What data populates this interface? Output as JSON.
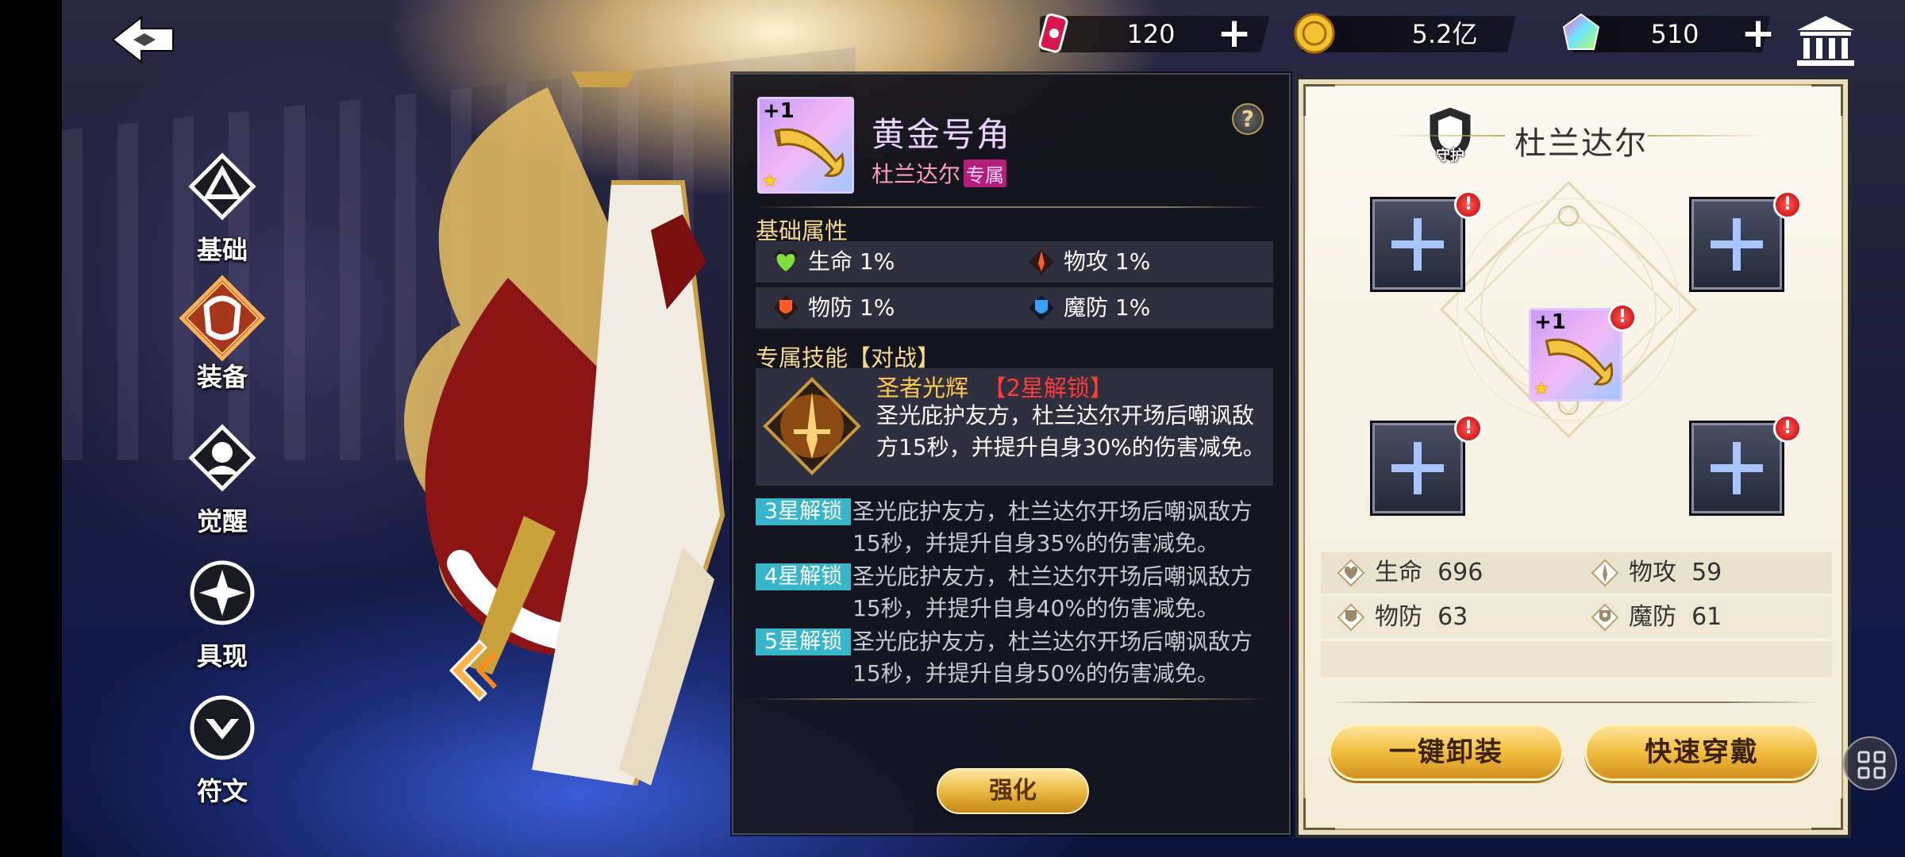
{
  "topbar": {
    "stamina": {
      "value": "120",
      "icon": "stamina-can-icon"
    },
    "gold": {
      "value": "5.2亿",
      "icon": "gold-coin-icon"
    },
    "gems": {
      "value": "510",
      "icon": "gem-icon"
    }
  },
  "nav": {
    "items": [
      {
        "label": "基础",
        "icon": "basics-icon"
      },
      {
        "label": "装备",
        "icon": "equipment-icon",
        "active": true
      },
      {
        "label": "觉醒",
        "icon": "awaken-icon"
      },
      {
        "label": "具现",
        "icon": "manifest-icon"
      },
      {
        "label": "符文",
        "icon": "rune-icon"
      }
    ]
  },
  "detail": {
    "item_level": "+1",
    "item_name": "黄金号角",
    "owner": "杜兰达尔",
    "exclusive_badge": "专属",
    "help": "?",
    "base_attr_title": "基础属性",
    "stats": [
      {
        "label": "生命 1%",
        "icon": "heart-icon",
        "color": "#7ee03c"
      },
      {
        "label": "物攻 1%",
        "icon": "sword-icon",
        "color": "#ff5a2a"
      },
      {
        "label": "物防 1%",
        "icon": "shield-icon",
        "color": "#ff5a2a"
      },
      {
        "label": "魔防 1%",
        "icon": "magic-shield-icon",
        "color": "#3ba0ff"
      }
    ],
    "skill_title": "专属技能【对战】",
    "skill": {
      "name": "圣者光辉",
      "lock": "【2星解锁】",
      "desc": "圣光庇护友方，杜兰达尔开场后嘲讽敌方15秒，并提升自身30%的伤害减免。"
    },
    "star_upgrades": [
      {
        "tag": "3星解锁",
        "desc": "圣光庇护友方，杜兰达尔开场后嘲讽敌方15秒，并提升自身35%的伤害减免。"
      },
      {
        "tag": "4星解锁",
        "desc": "圣光庇护友方，杜兰达尔开场后嘲讽敌方15秒，并提升自身40%的伤害减免。"
      },
      {
        "tag": "5星解锁",
        "desc": "圣光庇护友方，杜兰达尔开场后嘲讽敌方15秒，并提升自身50%的伤害减免。"
      }
    ],
    "enhance_label": "强化"
  },
  "equip": {
    "role_badge": "守护",
    "hero_name": "杜兰达尔",
    "center_item_level": "+1",
    "alert": "!",
    "stats": [
      {
        "label": "生命",
        "value": "696",
        "icon": "heart-outline-icon"
      },
      {
        "label": "物攻",
        "value": "59",
        "icon": "sword-outline-icon"
      },
      {
        "label": "物防",
        "value": "63",
        "icon": "shield-outline-icon"
      },
      {
        "label": "魔防",
        "value": "61",
        "icon": "magic-shield-outline-icon"
      }
    ],
    "unequip_all": "一键卸装",
    "quick_equip": "快速穿戴"
  }
}
